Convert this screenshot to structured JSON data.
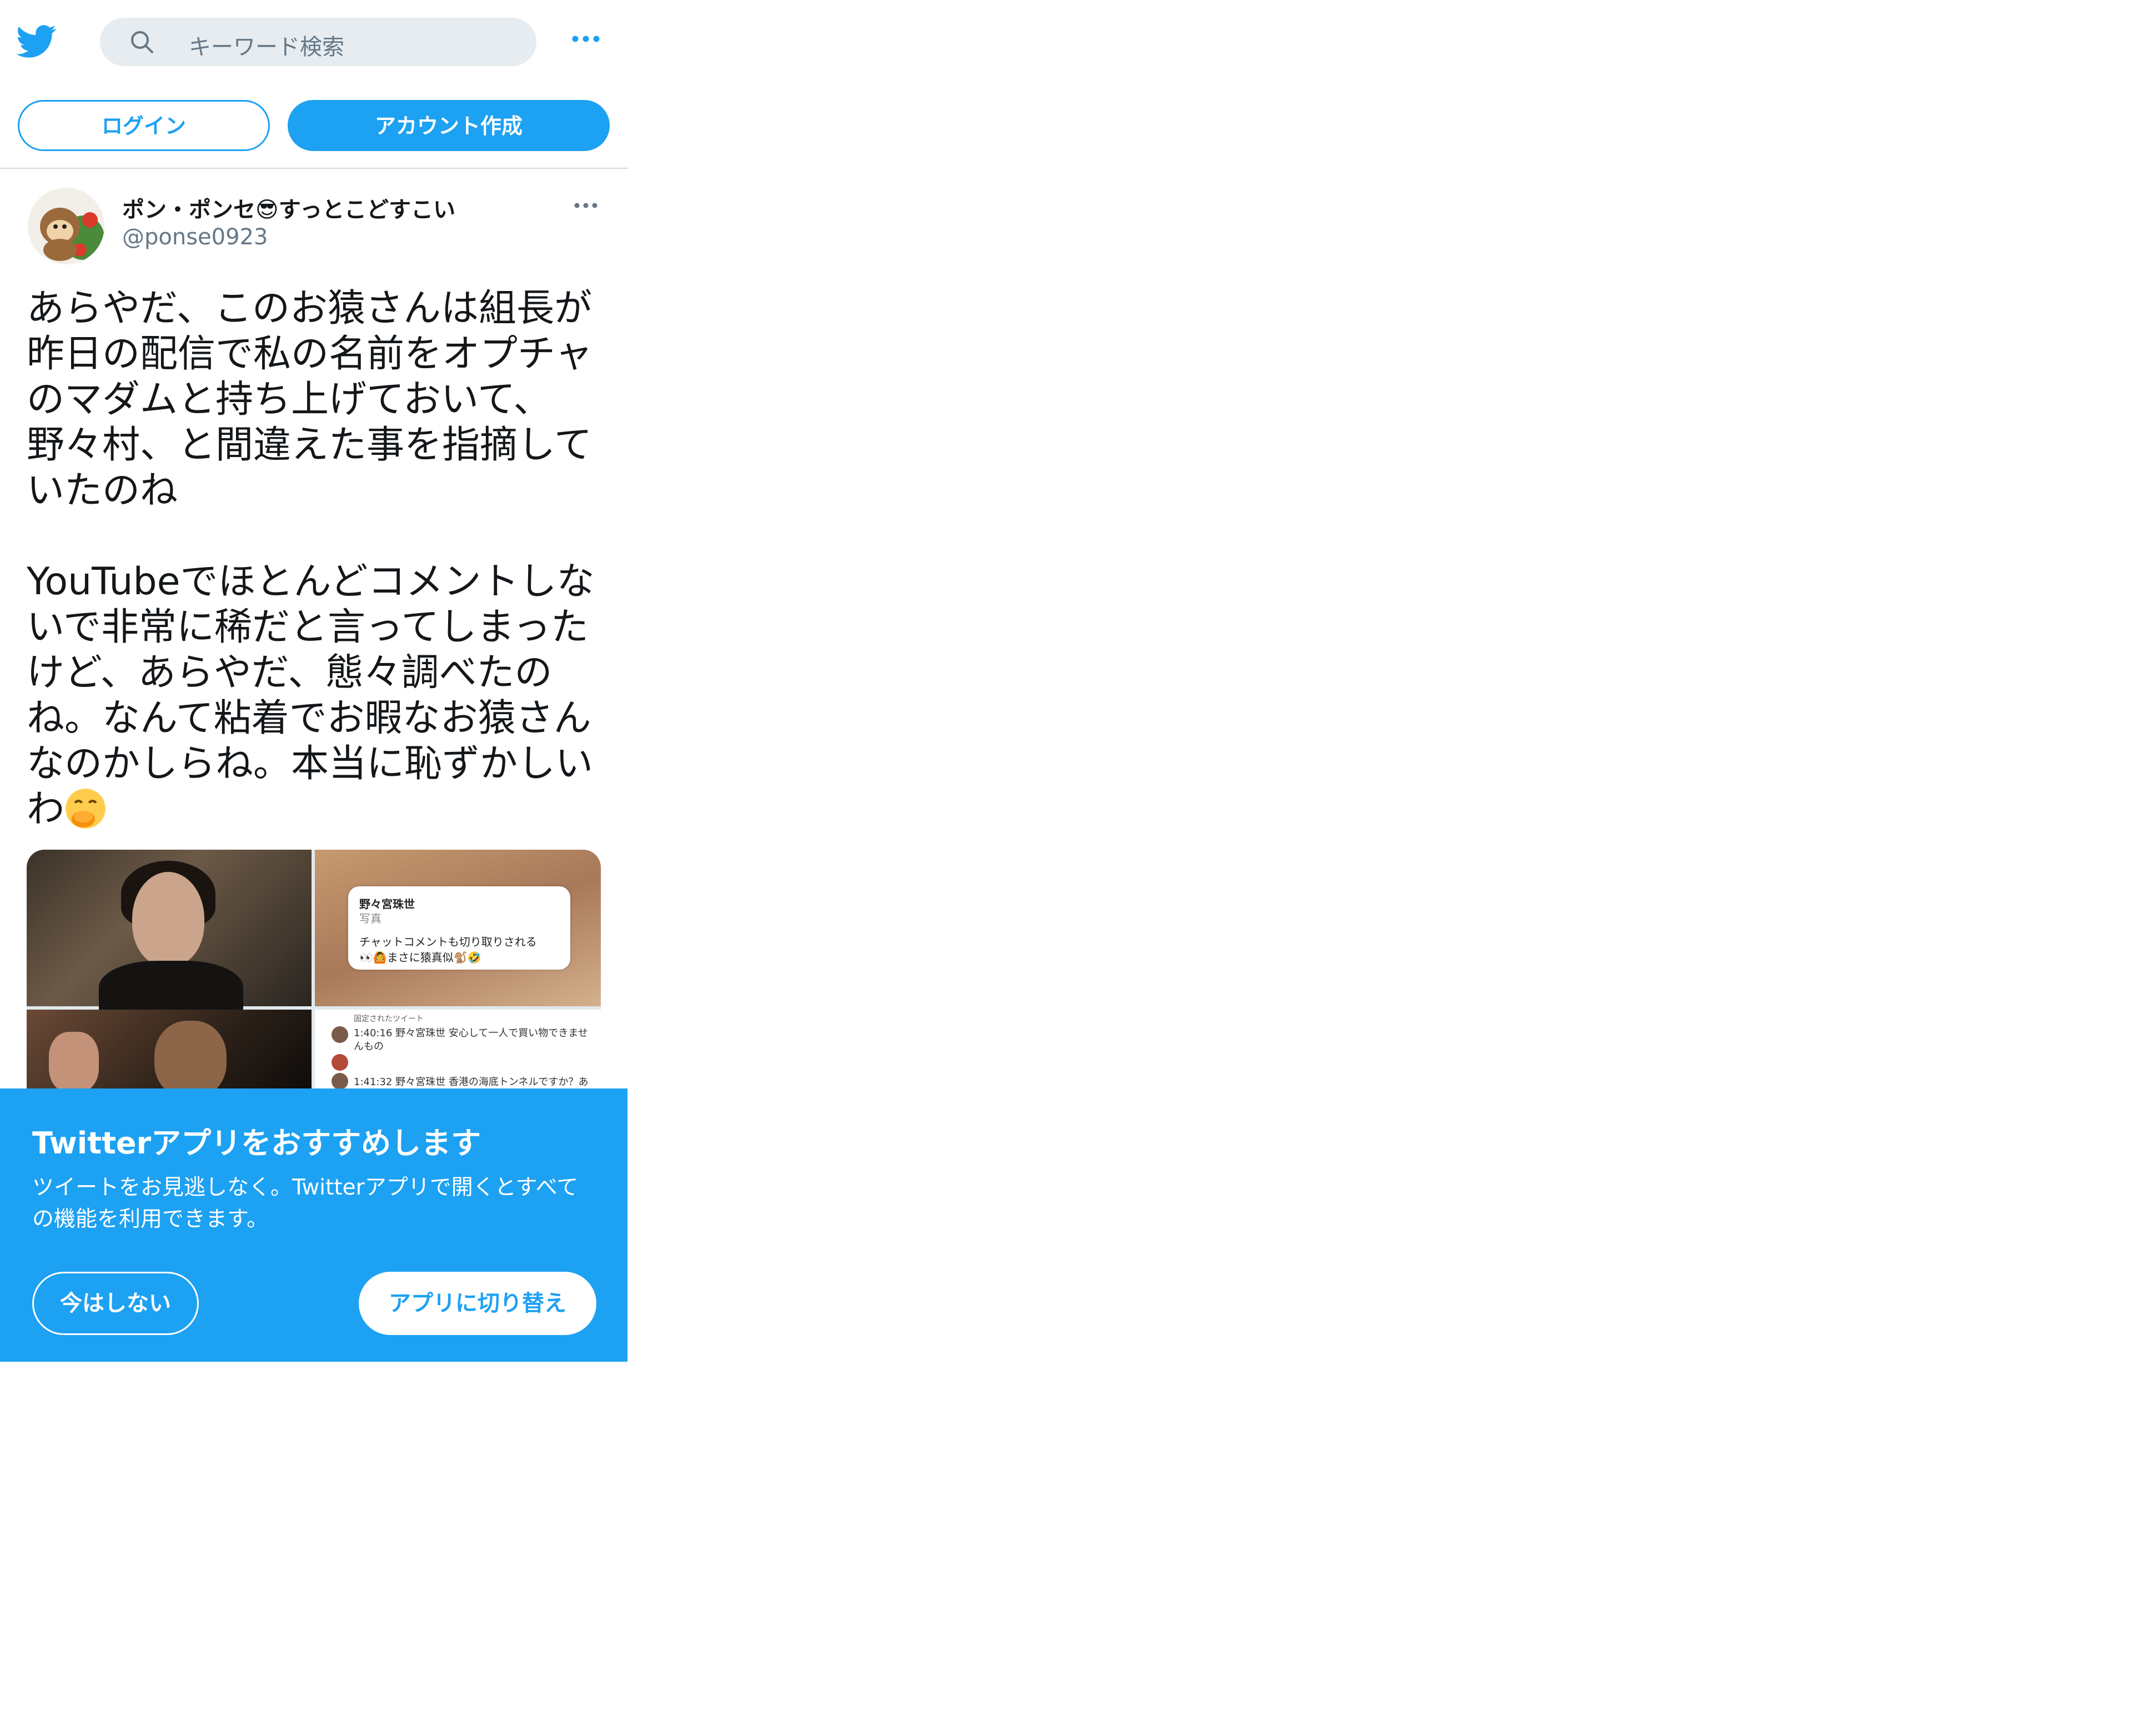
{
  "header": {
    "search_placeholder": "キーワード検索",
    "login_label": "ログイン",
    "signup_label": "アカウント作成"
  },
  "tweet": {
    "display_name": "ポン・ポンセ😎すっとこどすこい",
    "handle": "@ponse0923",
    "text_part1": "あらやだ、このお猿さんは組長が\n昨日の配信で私の名前をオプチャ\nのマダムと持ち上げておいて、\n野々村、と間違えた事を指摘して\nいたのね\n\nYouTubeでほとんどコメントしな\nいで非常に稀だと言ってしまった\nけど、あらやだ、態々調べたの\nね。なんて粘着でお暇なお猿さん\nなのかしらね。本当に恥ずかしい\nわ",
    "media": {
      "image2_name": "野々宮珠世",
      "image2_sub": "写真",
      "image2_line1": "チャットコメントも切り取りされる",
      "image2_line2": "👀🙆まさに猿真似🐒🤣",
      "image4_pinned": "固定されたツイート",
      "image4_row1": "1:40:16  野々宮珠世  安心して一人で買い物できませ",
      "image4_row1b": "んもの",
      "image4_row2": "1:41:32  野々宮珠世  香港の海底トンネルですか？あ"
    }
  },
  "banner": {
    "title": "Twitterアプリをおすすめします",
    "text": "ツイートをお見逃しなく。Twitterアプリで開くとすべての機能を利用できます。",
    "not_now_label": "今はしない",
    "switch_label": "アプリに切り替え"
  },
  "colors": {
    "accent": "#1da1f2",
    "search_bg": "#e6ecf0",
    "secondary_text": "#657786"
  }
}
